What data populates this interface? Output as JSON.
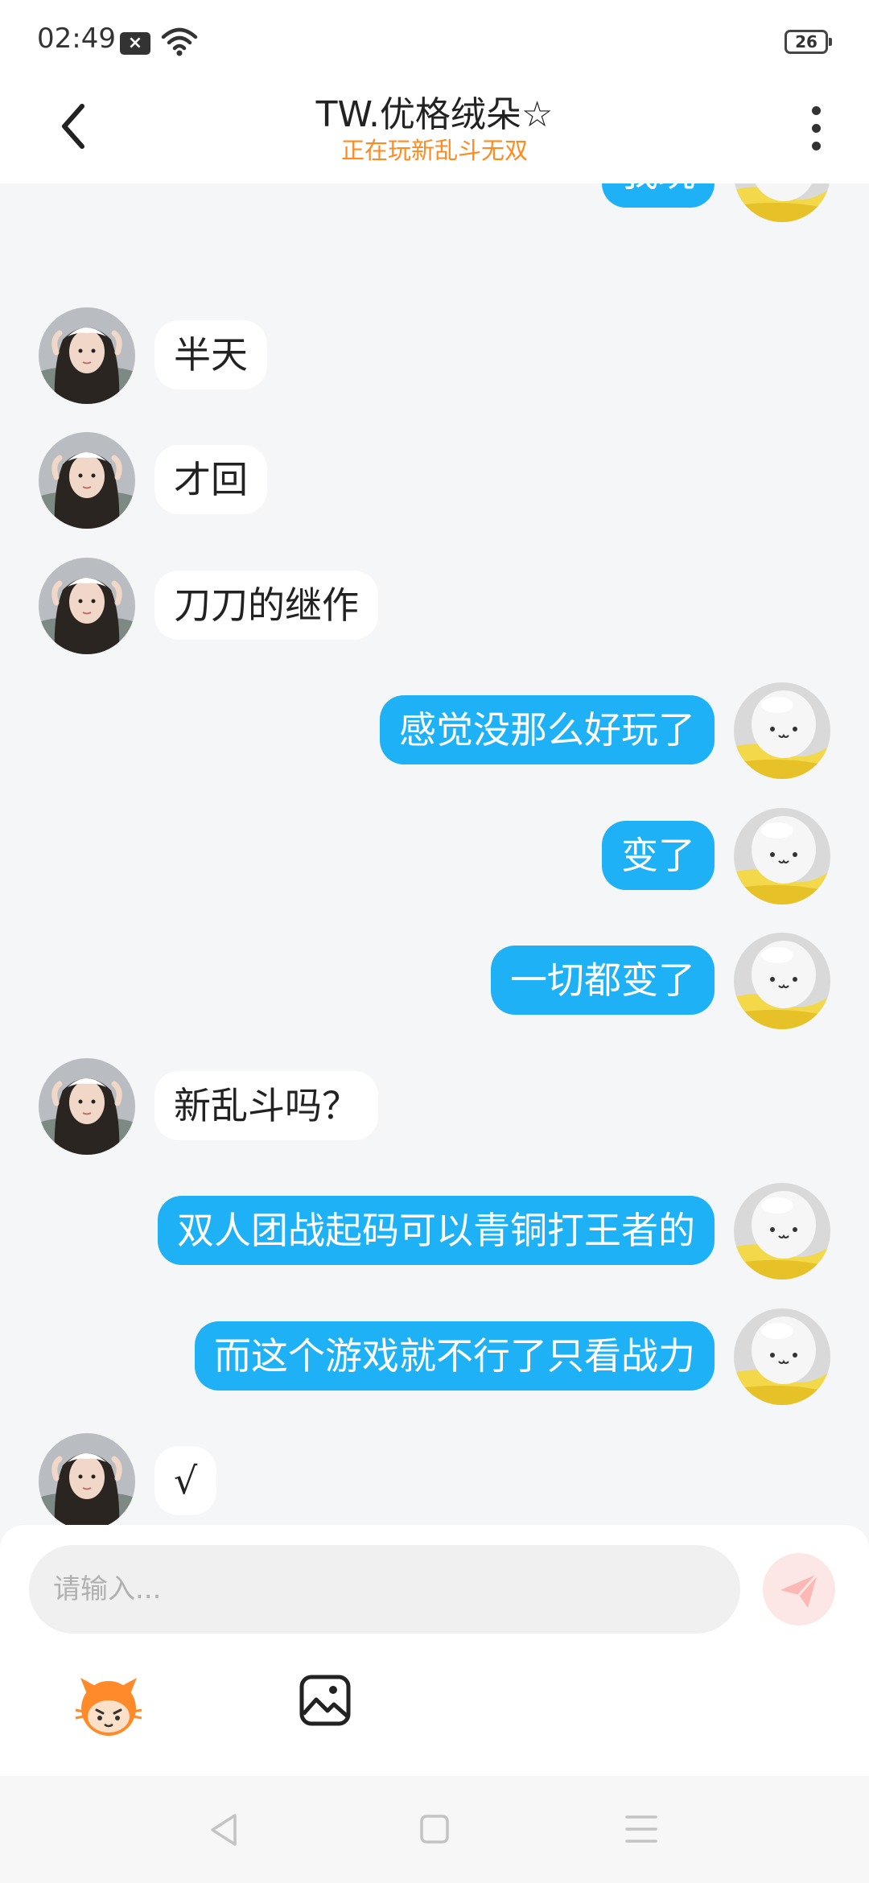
{
  "status_bar": {
    "time": "02:49",
    "notification_icon": "close-box-icon",
    "wifi_icon": "wifi-icon",
    "battery": "26"
  },
  "header": {
    "title": "TW.优格绒朵☆",
    "subtitle": "正在玩新乱斗无双",
    "back_icon": "chevron-left-icon",
    "more_icon": "more-vertical-icon"
  },
  "messages": [
    {
      "sender": "me",
      "text": "我玩"
    },
    {
      "sender": "other",
      "text": "半天"
    },
    {
      "sender": "other",
      "text": "才回"
    },
    {
      "sender": "other",
      "text": "刀刀的继作"
    },
    {
      "sender": "me",
      "text": "感觉没那么好玩了"
    },
    {
      "sender": "me",
      "text": "变了"
    },
    {
      "sender": "me",
      "text": "一切都变了"
    },
    {
      "sender": "other",
      "text": "新乱斗吗？"
    },
    {
      "sender": "me",
      "text": "双人团战起码可以青铜打王者的"
    },
    {
      "sender": "me",
      "text": "而这个游戏就不行了只看战力"
    },
    {
      "sender": "other",
      "text": "√"
    }
  ],
  "input": {
    "placeholder": "请输入...",
    "value": ""
  },
  "toolbar": {
    "send_icon": "send-icon",
    "emoji_icon": "mascot-emoji-icon",
    "image_icon": "image-icon"
  },
  "nav": {
    "back_icon": "nav-back-icon",
    "home_icon": "nav-home-icon",
    "menu_icon": "nav-menu-icon"
  },
  "colors": {
    "my_bubble": "#1fb1f5",
    "other_bubble": "#ffffff",
    "subtitle": "#ff8a1f",
    "background": "#f4f6f8"
  }
}
